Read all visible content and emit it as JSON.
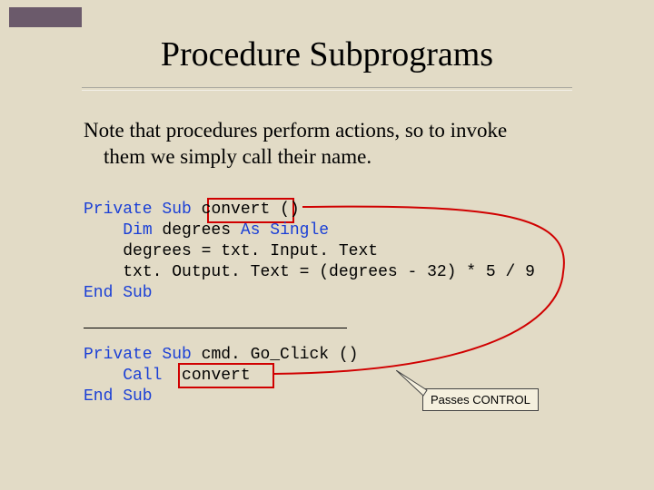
{
  "title": "Procedure Subprograms",
  "body": {
    "line1": "Note that procedures perform actions, so to invoke",
    "line2": "them we simply call their name."
  },
  "code": {
    "kw_private_sub": "Private Sub",
    "kw_end_sub": "End Sub",
    "kw_dim": "Dim",
    "kw_as": "As",
    "kw_single": "Single",
    "kw_call": "Call",
    "name_convert": "convert",
    "parens": "()",
    "line_dim": " degrees ",
    "line_assign1": "degrees = txt. Input. Text",
    "line_assign2": "txt. Output. Text = (degrees - 32) * 5 / 9",
    "name_cmdgo": "cmd. Go_Click ()",
    "call_name": "convert"
  },
  "callout": {
    "label": "Passes CONTROL"
  }
}
